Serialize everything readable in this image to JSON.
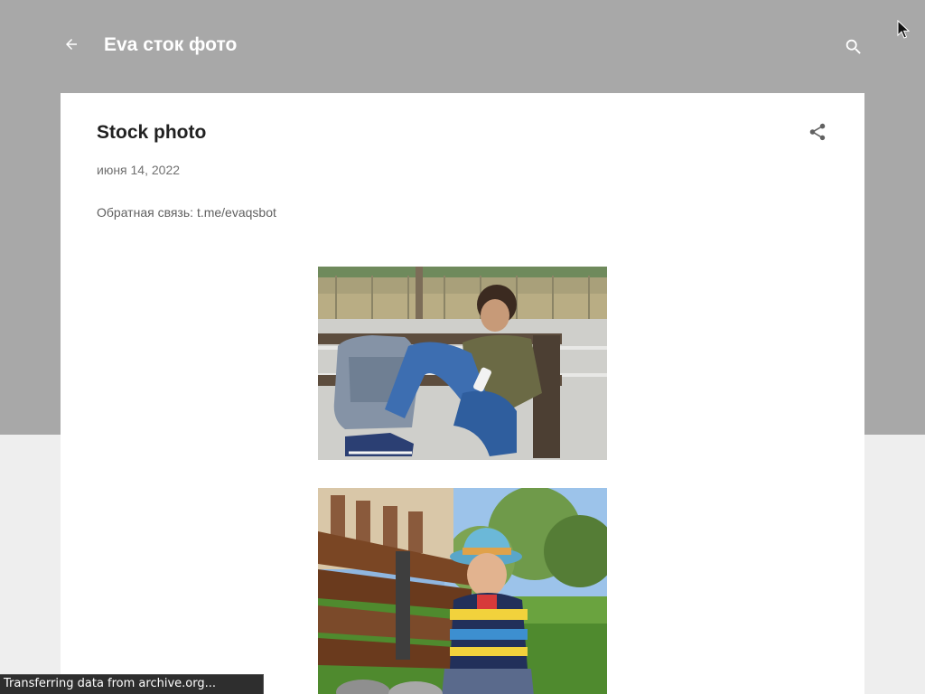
{
  "header": {
    "title": "Eva сток фото",
    "back_icon": "arrow-back-icon",
    "search_icon": "search-icon"
  },
  "post": {
    "title": "Stock photo",
    "date": "июня 14, 2022",
    "feedback_label": "Обратная связь: ",
    "feedback_link": "t.me/evaqsbot",
    "share_icon": "share-icon",
    "images": [
      {
        "subject": "boy-on-bench-with-backpack"
      },
      {
        "subject": "child-in-hat-on-bench"
      }
    ]
  },
  "status_bar": {
    "text": "Transferring data from archive.org..."
  },
  "colors": {
    "header_band": "#a8a8a8",
    "page_bg": "#eeeeee",
    "card_bg": "#ffffff",
    "title_text": "#212121",
    "meta_text": "#707070"
  }
}
